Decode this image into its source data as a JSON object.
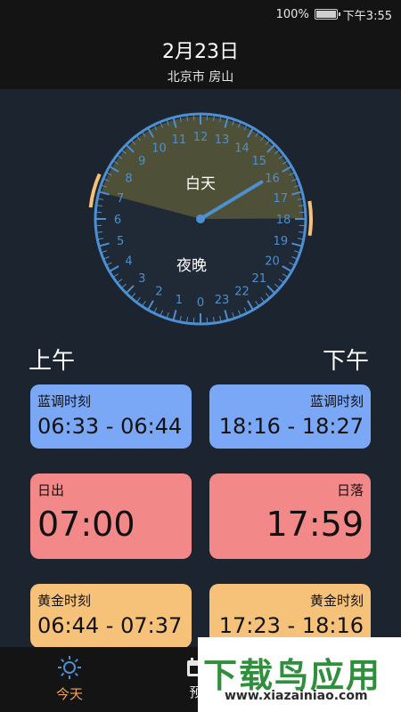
{
  "status": {
    "battery": "100%",
    "time": "下午3:55"
  },
  "header": {
    "date": "2月23日",
    "location": "北京市 房山"
  },
  "clock": {
    "numbers": [
      "0",
      "1",
      "2",
      "3",
      "4",
      "5",
      "6",
      "7",
      "8",
      "9",
      "10",
      "11",
      "12",
      "13",
      "14",
      "15",
      "16",
      "17",
      "18",
      "19",
      "20",
      "21",
      "22",
      "23"
    ],
    "day_label": "白天",
    "night_label": "夜晚",
    "sunrise_hour": 7.0,
    "sunset_hour": 17.98,
    "current_hour": 15.92
  },
  "labels": {
    "am": "上午",
    "pm": "下午"
  },
  "cards": {
    "blue_am": {
      "label": "蓝调时刻",
      "value": "06:33 - 06:44"
    },
    "blue_pm": {
      "label": "蓝调时刻",
      "value": "18:16 - 18:27"
    },
    "sunrise": {
      "label": "日出",
      "value": "07:00"
    },
    "sunset": {
      "label": "日落",
      "value": "17:59"
    },
    "gold_am": {
      "label": "黄金时刻",
      "value": "06:44 - 07:37"
    },
    "gold_pm": {
      "label": "黄金时刻",
      "value": "17:23 - 18:16"
    }
  },
  "nav": {
    "today": "今天",
    "forecast": "预"
  },
  "colors": {
    "today_active": "#f0a35a",
    "blue_card": "#7aa8f7",
    "red_card": "#f38888",
    "gold_card": "#f6c27a"
  },
  "watermark": {
    "title": "下载鸟应用",
    "url": "www.xiazainiao.com"
  }
}
